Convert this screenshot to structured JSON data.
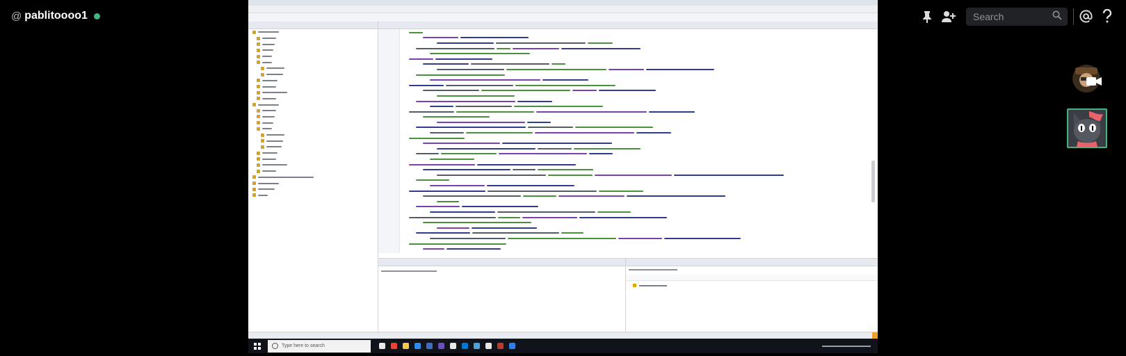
{
  "header": {
    "at_symbol": "@",
    "username": "pablitoooo1",
    "status_color": "#43b581"
  },
  "toolbar": {
    "search_placeholder": "Search",
    "icons": [
      "pin-icon",
      "add-friend-icon",
      "search-icon",
      "mention-icon",
      "help-icon"
    ]
  },
  "shared_screen": {
    "taskbar_search_placeholder": "Type here to search"
  },
  "participants": [
    {
      "name": "avatar-with-video-icon",
      "type": "audio"
    },
    {
      "name": "cat-video-tile",
      "type": "video",
      "active_border": "#43b581"
    }
  ]
}
